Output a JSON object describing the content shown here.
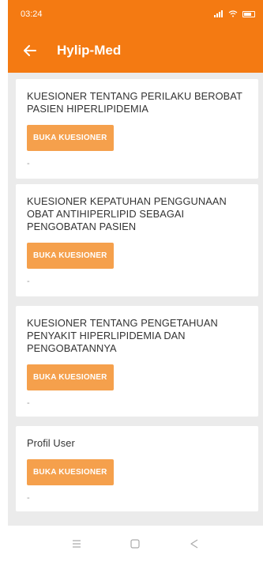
{
  "status_bar": {
    "time": "03:24",
    "icons": [
      "signal-icon",
      "wifi-icon",
      "battery-icon"
    ]
  },
  "app_bar": {
    "title": "Hylip-Med",
    "back_icon": "back-arrow-icon"
  },
  "cards": [
    {
      "title": "KUESIONER TENTANG PERILAKU BEROBAT PASIEN HIPERLIPIDEMIA",
      "button_label": "BUKA KUESIONER",
      "status": "-"
    },
    {
      "title": "KUESIONER KEPATUHAN PENGGUNAAN OBAT ANTIHIPERLIPID SEBAGAI PENGOBATAN PASIEN",
      "button_label": "BUKA KUESIONER",
      "status": "-"
    },
    {
      "title": "KUESIONER TENTANG PENGETAHUAN PENYAKIT HIPERLIPIDEMIA DAN PENGOBATANNYA",
      "button_label": "BUKA KUESIONER",
      "status": "-"
    },
    {
      "title": "Profil User",
      "button_label": "BUKA KUESIONER",
      "status": "-"
    }
  ],
  "nav_bar": {
    "buttons": [
      "menu-icon",
      "home-icon",
      "back-icon"
    ]
  },
  "colors": {
    "primary": "#f47a12",
    "button": "#f5a04c",
    "background": "#ebebeb"
  }
}
